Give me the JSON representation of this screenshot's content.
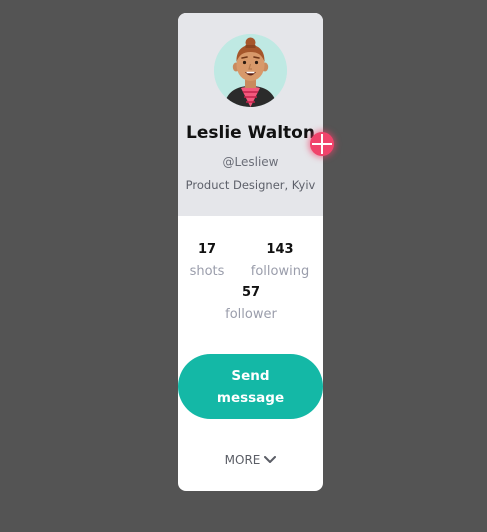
{
  "profile": {
    "name": "Leslie Walton",
    "handle": "@Lesliew",
    "role": "Product Designer, Kyiv"
  },
  "stats": [
    {
      "value": "17",
      "label": "shots"
    },
    {
      "value": "143",
      "label": "following"
    },
    {
      "value": "57",
      "label": "follower"
    }
  ],
  "actions": {
    "send_label": "Send message",
    "more_label": "MORE"
  },
  "icons": {
    "avatar": "avatar-illustration",
    "more": "chevron-down-icon",
    "add": "plus-icon"
  },
  "colors": {
    "background": "#545454",
    "card_header": "#e5e6ea",
    "accent": "#14b8a6",
    "add_button": "#f0436b"
  }
}
